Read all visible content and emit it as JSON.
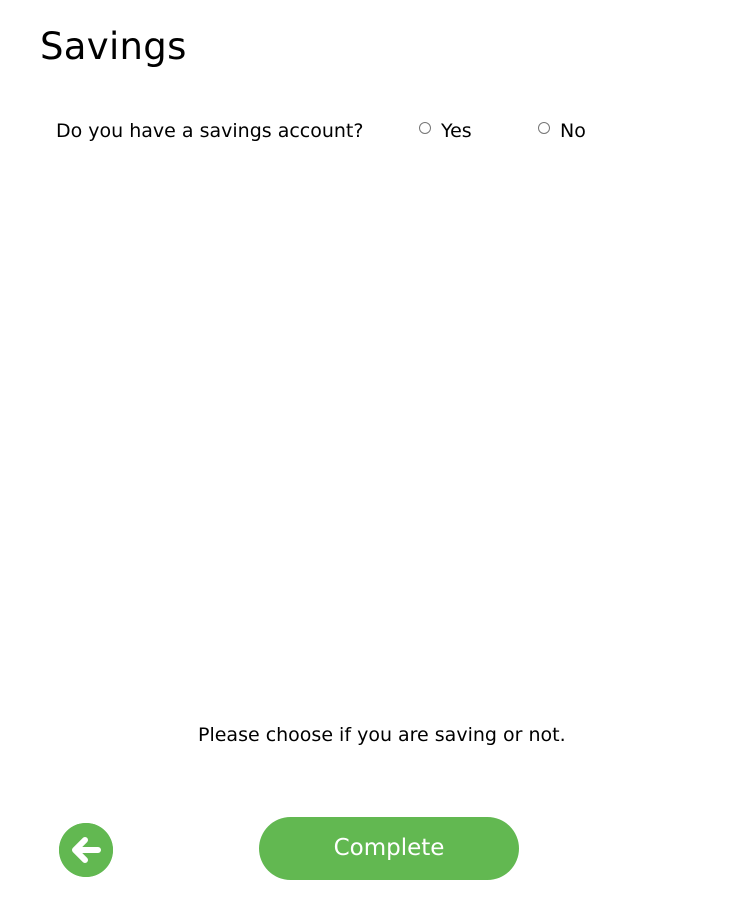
{
  "page": {
    "title": "Savings"
  },
  "question": {
    "label": "Do you have a savings account?",
    "options": [
      {
        "label": "Yes",
        "selected": false
      },
      {
        "label": "No",
        "selected": false
      }
    ]
  },
  "hint": "Please choose if you are saving or not.",
  "footer": {
    "back_icon": "arrow-left-icon",
    "complete_label": "Complete"
  },
  "colors": {
    "accent": "#62b851",
    "text": "#000000",
    "background": "#ffffff",
    "radio_border": "#767676"
  }
}
